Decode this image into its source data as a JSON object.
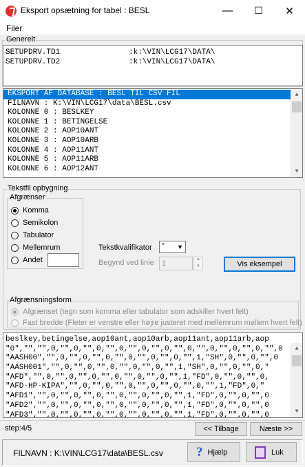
{
  "window": {
    "title": "Eksport opsætning for tabel : BESL",
    "minimize": "—",
    "maximize": "☐",
    "close": "✕"
  },
  "menu": {
    "file": "Filer"
  },
  "general": {
    "legend": "Generelt",
    "rows": [
      {
        "key": "SETUPDRV.TD1",
        "value": ":k:\\VIN\\LCG17\\DATA\\"
      },
      {
        "key": "SETUPDRV.TD2",
        "value": ":k:\\VIN\\LCG17\\DATA\\"
      }
    ]
  },
  "export_list": {
    "items": [
      "EKSPORT AF DATABASE : BESL TIL CSV FIL",
      "FILNAVN : K:\\VIN\\LCG17\\data\\BESL.csv",
      "KOLONNE 0 : BESLKEY",
      "KOLONNE 1 : BETINGELSE",
      "KOLONNE 2 : AOP10ANT",
      "KOLONNE 3 : AOP10ARB",
      "KOLONNE 4 : AOP11ANT",
      "KOLONNE 5 : AOP11ARB",
      "KOLONNE 6 : AOP12ANT"
    ],
    "selected_index": 0
  },
  "textfile": {
    "legend": "Tekstfil opbygning",
    "delimiters": {
      "legend": "Afgrænser",
      "options": [
        "Komma",
        "Semikolon",
        "Tabulator",
        "Mellemrum",
        "Andet"
      ],
      "selected": "Komma",
      "other_value": ""
    },
    "qualifier_label": "Tekstkvalifikator",
    "qualifier_value": "\"",
    "start_line_label": "Begynd ved linie",
    "start_line_value": "1",
    "show_example_button": "Vis eksempel"
  },
  "delimit_form": {
    "legend": "Afgrænsningsform",
    "options": [
      "Afgrænset (tegn som komma eller tabulator som adskiller hvert felt)",
      "Fast bredde (Fleter er venstre eller højre justeret med mellemrum mellem hvert felt)"
    ],
    "selected_index": 0
  },
  "preview": {
    "lines": [
      "beslkey,betingelse,aop10ant,aop10arb,aop11ant,aop11arb,aop",
      "\"0\",\"\",\"\",0,\"\",0,\"\",0,\"\",0,\"\",0,\"\",0,\"\",0,\"\",0,\"\",0,\"\",0,\"\",0",
      "\"AASH00\",\"\",0,\"\",0,\"\",0,\"\",0,\"\",0,\"\",0,\"\",1,\"SH\",0,\"\",0,\"\",0",
      "\"AASH001\",\"\",0,\"\",0,\"\",0,\"\",0,\"\",0,\"\",1,\"SH\",0,\"\",0,\"\",0,\"",
      "\"AFD\",\"\",0,\"\",0,\"\",0,\"\",0,\"\",0,\"\",0,\"\",1,\"FD\",0,\"\",0,\"\",0,",
      "\"AFD-HP-KIPA\",\"\",0,\"\",0,\"\",0,\"\",0,\"\",0,\"\",0,\"\",1,\"FD\",0,\"",
      "\"AFD1\",\"\",0,\"\",0,\"\",0,\"\",0,\"\",0,\"\",0,\"\",1,\"FD\",0,\"\",0,\"\",0",
      "\"AFD2\",\"\",0,\"\",0,\"\",0,\"\",0,\"\",0,\"\",0,\"\",1,\"FD\",0,\"\",0,\"\",0",
      "\"AFD3\",\"\",0,\"\",0,\"\",0,\"\",0,\"\",0,\"\",0,\"\",1,\"FD\",0,\"\",0,\"\",0"
    ]
  },
  "footer": {
    "step": "step:4/5",
    "back_button": "<< Tilbage",
    "next_button": "Næste >>",
    "filename": "FILNAVN : K:\\VIN\\LCG17\\data\\BESL.csv",
    "help_button": "Hjælp",
    "close_button": "Luk"
  },
  "colors": {
    "selection": "#0078d7",
    "focus_border": "#0078d7",
    "help_icon": "#1e5fd8",
    "close_icon": "#7a3fb0"
  },
  "icons": {
    "app": "app-logo-icon",
    "help": "question-icon",
    "close": "exit-door-icon"
  }
}
